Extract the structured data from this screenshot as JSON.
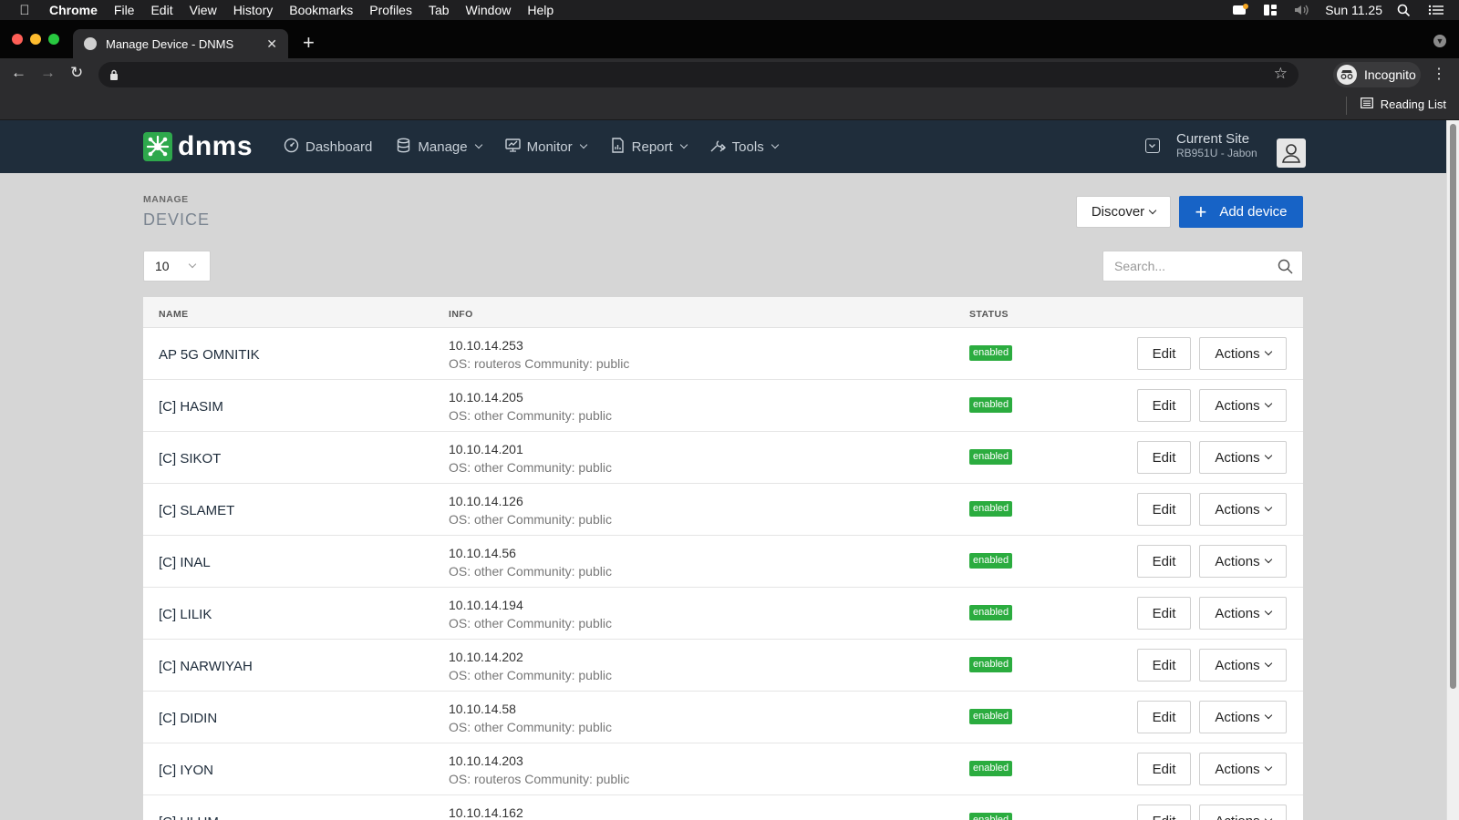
{
  "os_menubar": {
    "app_name": "Chrome",
    "items": [
      "File",
      "Edit",
      "View",
      "History",
      "Bookmarks",
      "Profiles",
      "Tab",
      "Window",
      "Help"
    ],
    "clock": "Sun 11.25"
  },
  "browser": {
    "tab_title": "Manage Device - DNMS",
    "url": "",
    "profile_label": "Incognito",
    "reading_list_label": "Reading List"
  },
  "app": {
    "logo_text": "dnms",
    "nav": {
      "dashboard": "Dashboard",
      "manage": "Manage",
      "monitor": "Monitor",
      "report": "Report",
      "tools": "Tools"
    },
    "current_site_label": "Current Site",
    "current_site_value": "RB951U - Jabon"
  },
  "page": {
    "breadcrumb": "MANAGE",
    "title": "DEVICE",
    "discover_label": "Discover",
    "add_device_label": "Add device",
    "page_size": "10",
    "search_placeholder": "Search..."
  },
  "table": {
    "columns": {
      "name": "NAME",
      "info": "INFO",
      "status": "STATUS"
    },
    "edit_label": "Edit",
    "actions_label": "Actions",
    "rows": [
      {
        "name": "AP 5G OMNITIK",
        "ip": "10.10.14.253",
        "meta": "OS: routeros Community: public",
        "status": "enabled"
      },
      {
        "name": "[C] HASIM",
        "ip": "10.10.14.205",
        "meta": "OS: other Community: public",
        "status": "enabled"
      },
      {
        "name": "[C] SIKOT",
        "ip": "10.10.14.201",
        "meta": "OS: other Community: public",
        "status": "enabled"
      },
      {
        "name": "[C] SLAMET",
        "ip": "10.10.14.126",
        "meta": "OS: other Community: public",
        "status": "enabled"
      },
      {
        "name": "[C] INAL",
        "ip": "10.10.14.56",
        "meta": "OS: other Community: public",
        "status": "enabled"
      },
      {
        "name": "[C] LILIK",
        "ip": "10.10.14.194",
        "meta": "OS: other Community: public",
        "status": "enabled"
      },
      {
        "name": "[C] NARWIYAH",
        "ip": "10.10.14.202",
        "meta": "OS: other Community: public",
        "status": "enabled"
      },
      {
        "name": "[C] DIDIN",
        "ip": "10.10.14.58",
        "meta": "OS: other Community: public",
        "status": "enabled"
      },
      {
        "name": "[C] IYON",
        "ip": "10.10.14.203",
        "meta": "OS: routeros Community: public",
        "status": "enabled"
      },
      {
        "name": "[C] ULUM",
        "ip": "10.10.14.162",
        "meta": "",
        "status": "enabled"
      }
    ]
  },
  "colors": {
    "header_bg": "#1f2d3b",
    "accent_blue": "#1763c6",
    "status_green": "#2bac3f",
    "logo_green": "#2ea84c"
  }
}
